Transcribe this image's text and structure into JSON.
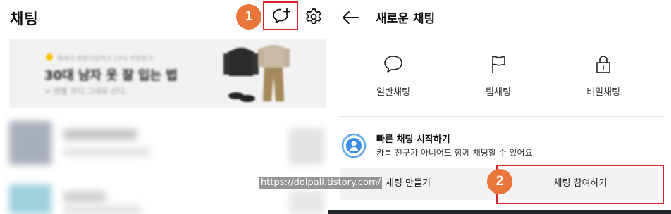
{
  "left_panel": {
    "title": "채팅",
    "step_badge_1": "1",
    "ad": {
      "small_text": "톡에서 회원가입하고 15% 쿠폰받기",
      "headline": "30대 남자 옷 잘 입는 법",
      "sub_text": "> 댄블 코디 그대로 산다."
    }
  },
  "right_panel": {
    "title": "새로운 채팅",
    "chat_types": [
      {
        "label": "일반채팅",
        "icon": "chat-bubble-icon"
      },
      {
        "label": "팀채팅",
        "icon": "flag-icon"
      },
      {
        "label": "비밀채팅",
        "icon": "lock-icon"
      }
    ],
    "quick_chat": {
      "title": "빠른 채팅 시작하기",
      "description": "카톡 친구가 아니어도 함께 채팅할 수 있어요."
    },
    "buttons": {
      "create": "채팅 만들기",
      "join": "채팅 참여하기"
    },
    "step_badge_2": "2"
  },
  "watermark": "https://dolpali.tistory.com/",
  "colors": {
    "highlight_border": "#d9232a",
    "badge": "#e9763a",
    "button_bg": "#f2f2f2",
    "quick_chat_icon": "#3a8ee6"
  }
}
